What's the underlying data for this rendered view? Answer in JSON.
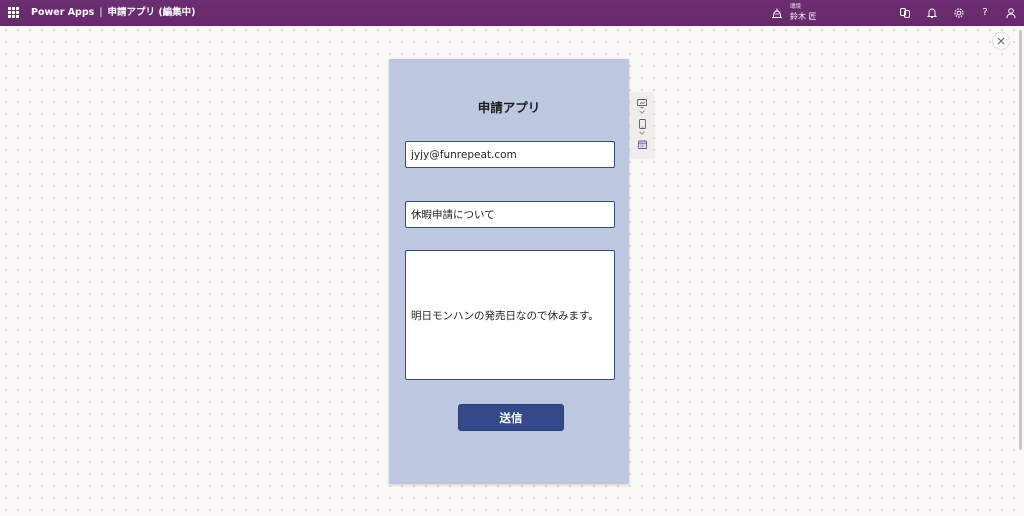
{
  "header": {
    "app_name": "Power Apps",
    "separator": "|",
    "document_title": "申請アプリ (編集中)",
    "environment_label": "環境",
    "environment_name": "鈴木 匠",
    "icons": [
      "app-launcher-icon",
      "copilot-icon",
      "bell-icon",
      "gear-icon",
      "help-icon",
      "person-icon"
    ],
    "help_glyph": "?"
  },
  "canvas": {
    "close_icon": "close-icon",
    "side_tools": [
      "desktop-icon",
      "chevron-down-icon",
      "phone-icon",
      "chevron-down-icon",
      "calendar-icon"
    ]
  },
  "app": {
    "title": "申請アプリ",
    "email_value": "jyjy@funrepeat.com",
    "subject_value": "休暇申請について",
    "body_value": "明日モンハンの発売日なので休みます。",
    "submit_label": "送信"
  },
  "colors": {
    "topbar": "#6a2c70",
    "screen_background": "#bcc8e0",
    "button": "#34498a",
    "field_border": "#3a4a80"
  }
}
